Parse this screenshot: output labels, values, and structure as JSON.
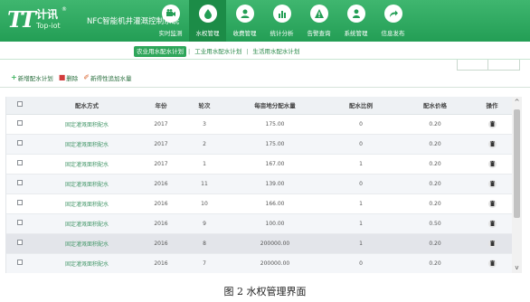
{
  "app": {
    "logo_mark": "TT",
    "logo_cn": "计讯",
    "logo_reg": "®",
    "logo_en": "Top-iot",
    "system_title": "NFC智能机井灌溉控制系统"
  },
  "nav": [
    {
      "label": "实时监测",
      "icon": "camera-icon",
      "active": false
    },
    {
      "label": "水权管理",
      "icon": "water-drop-icon",
      "active": true
    },
    {
      "label": "收费管理",
      "icon": "user-fee-icon",
      "active": false
    },
    {
      "label": "统计分析",
      "icon": "bar-chart-icon",
      "active": false
    },
    {
      "label": "告警查询",
      "icon": "warning-icon",
      "active": false
    },
    {
      "label": "系统管理",
      "icon": "user-icon",
      "active": false
    },
    {
      "label": "信息发布",
      "icon": "share-icon",
      "active": false
    }
  ],
  "subtabs": [
    {
      "label": "农业用水配水计划",
      "active": true
    },
    {
      "label": "工业用水配水计划",
      "active": false
    },
    {
      "label": "生活用水配水计划",
      "active": false
    }
  ],
  "subtab_separator": "|",
  "toolbar": {
    "add_label": "新增配水计划",
    "delete_label": "删除",
    "append_label": "新得性追加水量",
    "add_icon": "+",
    "delete_icon": "■",
    "append_icon": "✐"
  },
  "table": {
    "headers": [
      "",
      "配水方式",
      "年份",
      "轮次",
      "每亩地分配水量",
      "配水比例",
      "配水价格",
      "操作"
    ],
    "rows": [
      {
        "method": "固定灌溉面积配水",
        "year": "2017",
        "round": "3",
        "amount": "175.00",
        "ratio": "0",
        "price": "0.20"
      },
      {
        "method": "固定灌溉面积配水",
        "year": "2017",
        "round": "2",
        "amount": "175.00",
        "ratio": "0",
        "price": "0.20"
      },
      {
        "method": "固定灌溉面积配水",
        "year": "2017",
        "round": "1",
        "amount": "167.00",
        "ratio": "1",
        "price": "0.20"
      },
      {
        "method": "固定灌溉面积配水",
        "year": "2016",
        "round": "11",
        "amount": "139.00",
        "ratio": "0",
        "price": "0.20"
      },
      {
        "method": "固定灌溉面积配水",
        "year": "2016",
        "round": "10",
        "amount": "166.00",
        "ratio": "1",
        "price": "0.20"
      },
      {
        "method": "固定灌溉面积配水",
        "year": "2016",
        "round": "9",
        "amount": "100.00",
        "ratio": "1",
        "price": "0.50"
      },
      {
        "method": "固定灌溉面积配水",
        "year": "2016",
        "round": "8",
        "amount": "200000.00",
        "ratio": "1",
        "price": "0.20"
      },
      {
        "method": "固定灌溉面积配水",
        "year": "2016",
        "round": "7",
        "amount": "200000.00",
        "ratio": "0",
        "price": "0.20"
      }
    ],
    "highlighted_row_index": 6
  },
  "scrollbar": {
    "up": "^",
    "down": "v"
  },
  "caption": "图 2  水权管理界面",
  "colors": {
    "header_green": "#2aa35a",
    "active_nav": "#1c8c47",
    "method_text": "#4a9a6e"
  }
}
